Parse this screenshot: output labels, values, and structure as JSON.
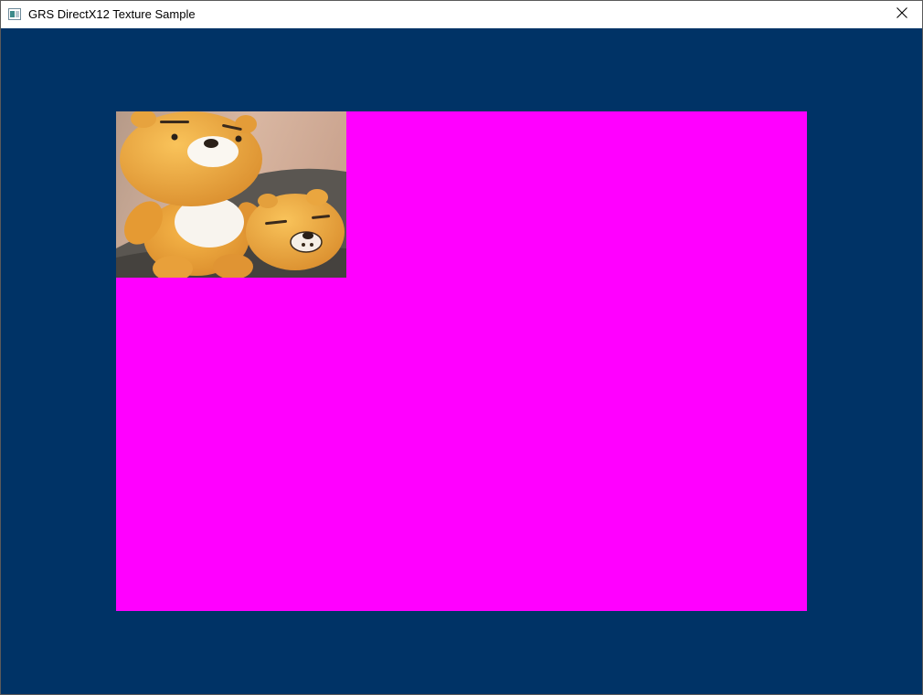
{
  "window": {
    "title": "GRS DirectX12 Texture Sample",
    "icon": "app-window-icon",
    "close_icon": "close-icon"
  },
  "render": {
    "clear_color": "#003366",
    "quad_color": "#ff00ff",
    "texture": {
      "subject": "two orange bear plush toys",
      "icon": "plush-bear-texture"
    }
  },
  "colors": {
    "titlebar_bg": "#ffffff",
    "title_text": "#000000",
    "plush_orange": "#f0a83a",
    "plush_white": "#f8f4ee",
    "background_wall": "#c9a891",
    "background_couch": "#4a4743"
  }
}
